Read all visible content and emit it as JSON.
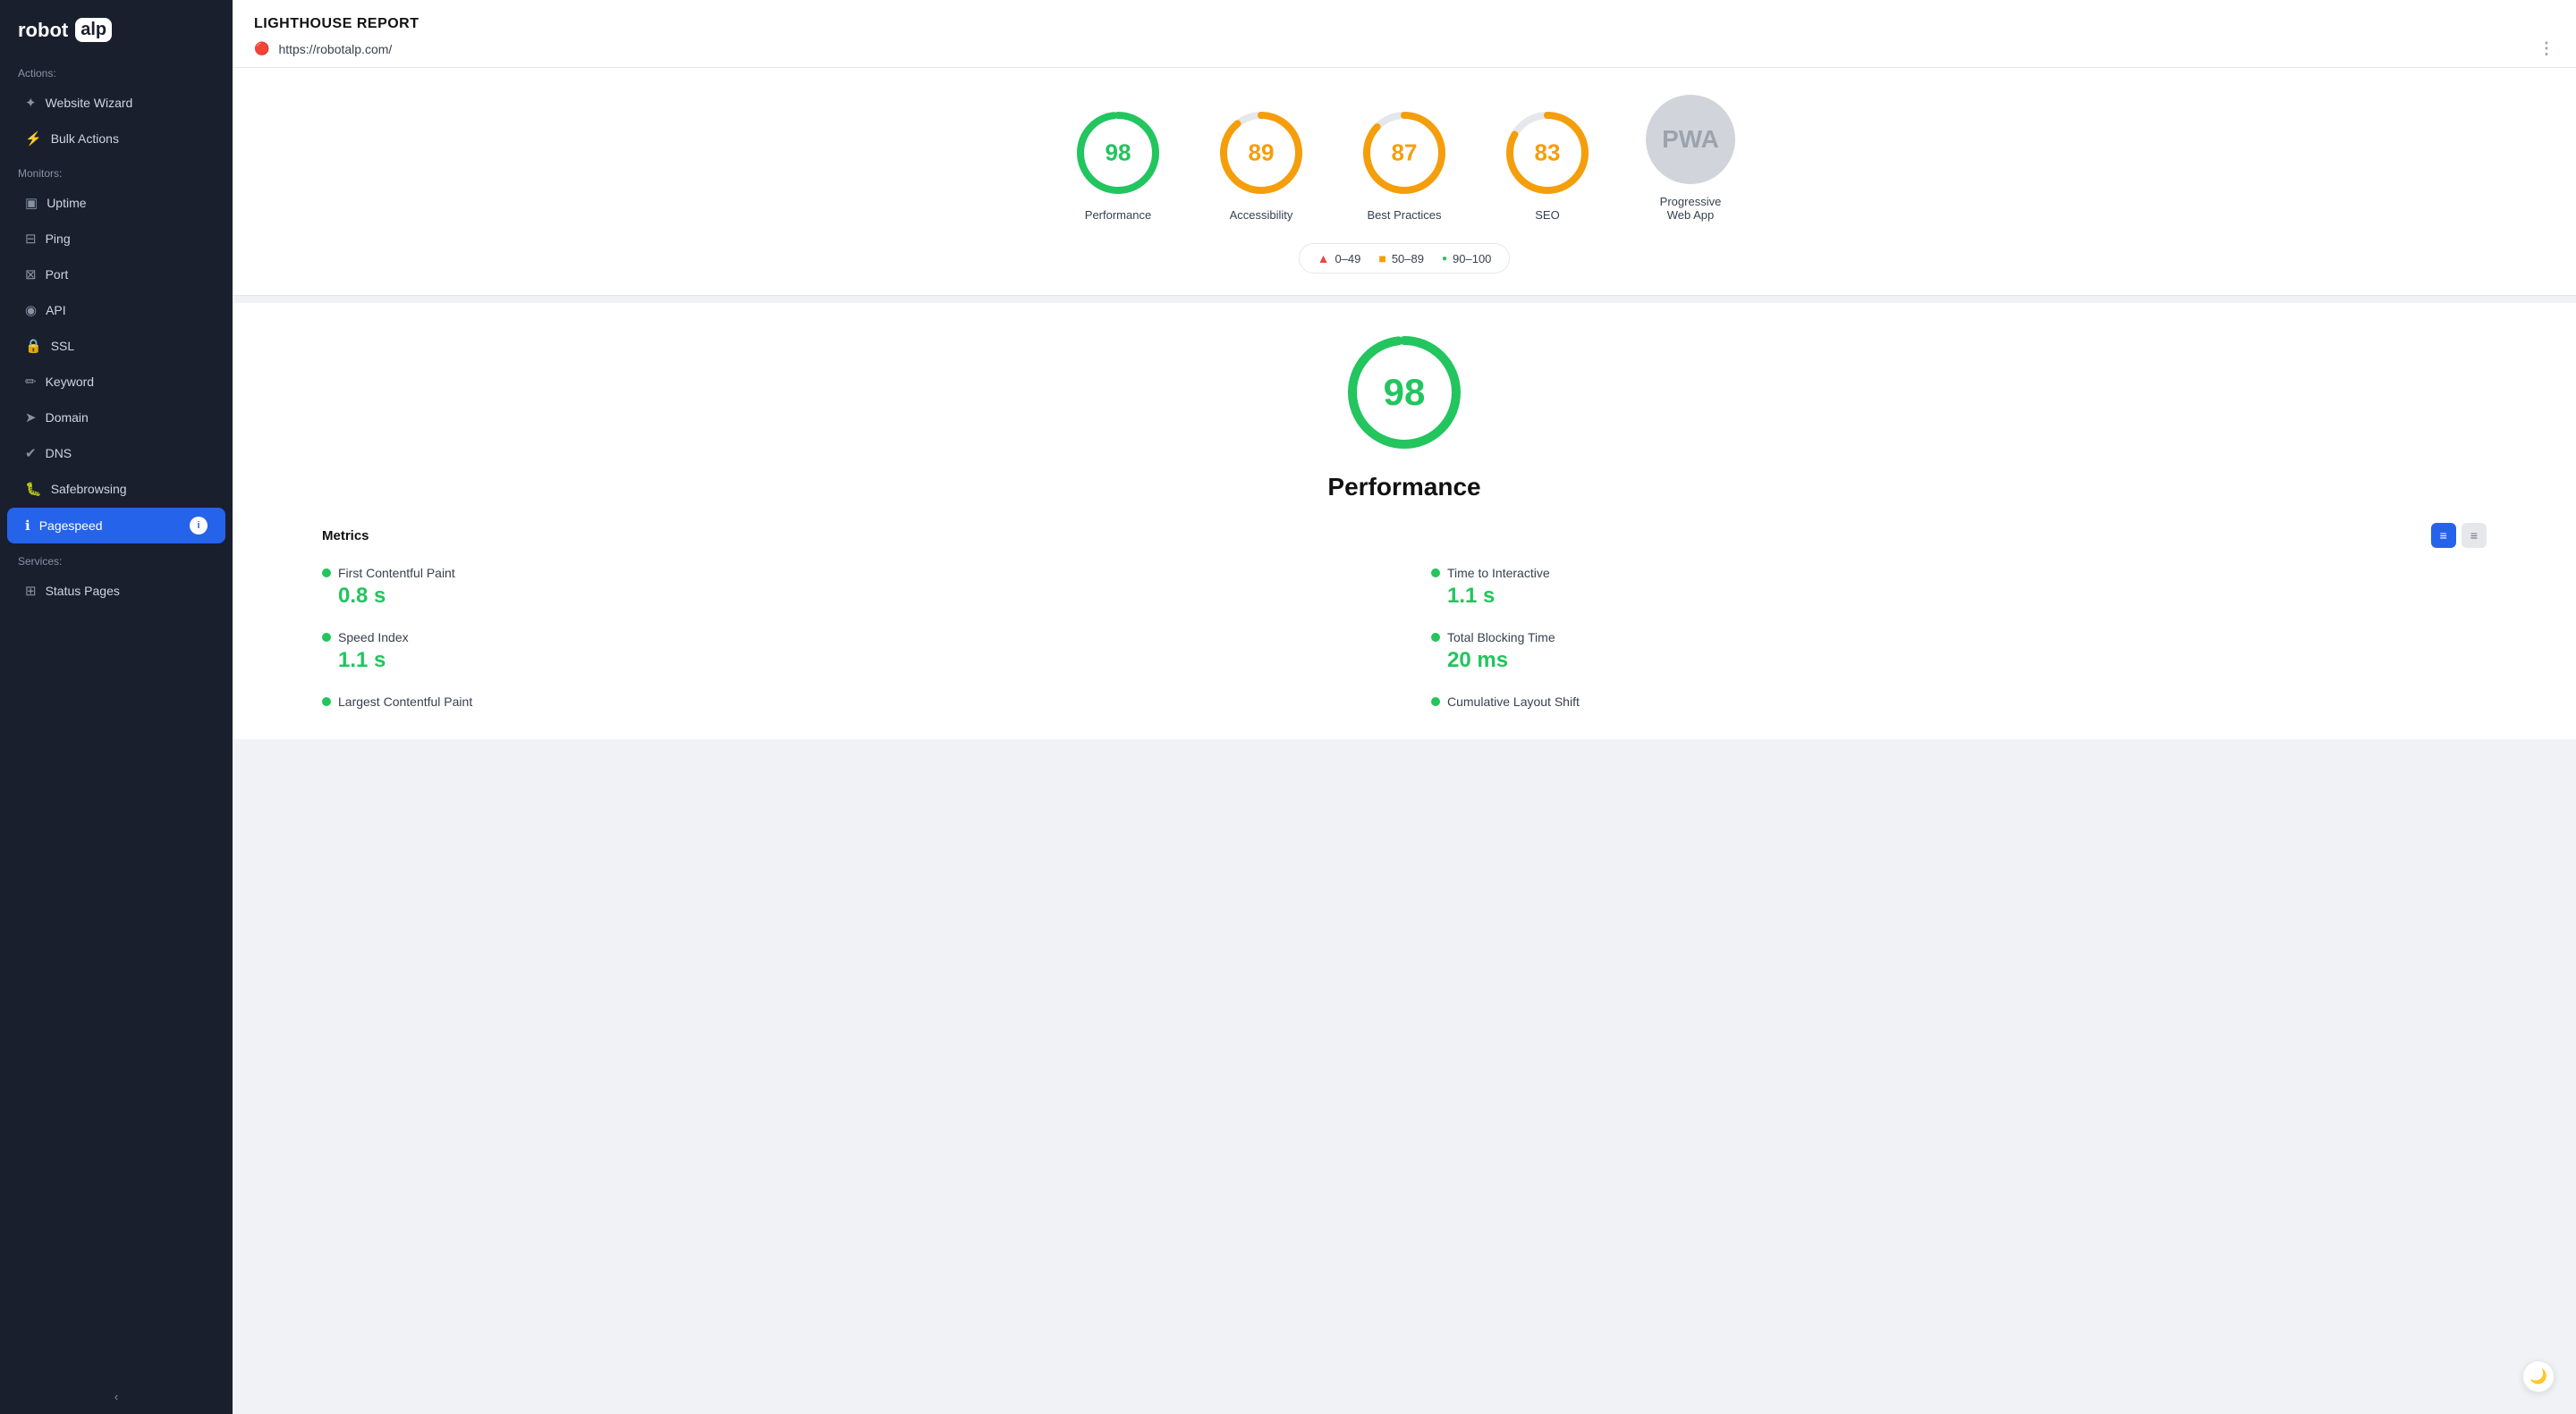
{
  "app": {
    "name": "robot",
    "logo_highlight": "alp"
  },
  "sidebar": {
    "sections": [
      {
        "label": "Actions:",
        "items": [
          {
            "id": "website-wizard",
            "label": "Website Wizard",
            "icon": "✦",
            "active": false
          },
          {
            "id": "bulk-actions",
            "label": "Bulk Actions",
            "icon": "⚡",
            "active": false
          }
        ]
      },
      {
        "label": "Monitors:",
        "items": [
          {
            "id": "uptime",
            "label": "Uptime",
            "icon": "▣",
            "active": false
          },
          {
            "id": "ping",
            "label": "Ping",
            "icon": "⊟",
            "active": false
          },
          {
            "id": "port",
            "label": "Port",
            "icon": "⊠",
            "active": false
          },
          {
            "id": "api",
            "label": "API",
            "icon": "◉",
            "active": false
          },
          {
            "id": "ssl",
            "label": "SSL",
            "icon": "🔒",
            "active": false
          },
          {
            "id": "keyword",
            "label": "Keyword",
            "icon": "✏",
            "active": false
          },
          {
            "id": "domain",
            "label": "Domain",
            "icon": "➤",
            "active": false
          },
          {
            "id": "dns",
            "label": "DNS",
            "icon": "✔",
            "active": false
          },
          {
            "id": "safebrowsing",
            "label": "Safebrowsing",
            "icon": "🐛",
            "active": false
          },
          {
            "id": "pagespeed",
            "label": "Pagespeed",
            "icon": "ℹ",
            "active": true
          }
        ]
      },
      {
        "label": "Services:",
        "items": [
          {
            "id": "status-pages",
            "label": "Status Pages",
            "icon": "⊞",
            "active": false
          }
        ]
      }
    ],
    "collapse_label": "‹"
  },
  "report": {
    "title": "LIGHTHOUSE REPORT",
    "url": "https://robotalp.com/",
    "url_icon": "🔴",
    "scores": [
      {
        "id": "performance",
        "value": 98,
        "label": "Performance",
        "color": "green",
        "stroke_color": "#22c55e",
        "percent": 98
      },
      {
        "id": "accessibility",
        "value": 89,
        "label": "Accessibility",
        "color": "orange",
        "stroke_color": "#f59e0b",
        "percent": 89
      },
      {
        "id": "best-practices",
        "value": 87,
        "label": "Best Practices",
        "color": "orange",
        "stroke_color": "#f59e0b",
        "percent": 87
      },
      {
        "id": "seo",
        "value": 83,
        "label": "SEO",
        "color": "orange",
        "stroke_color": "#f59e0b",
        "percent": 83
      }
    ],
    "pwa": {
      "label": "Progressive\nWeb App",
      "value": "—"
    },
    "legend": [
      {
        "id": "low",
        "range": "0–49",
        "color": "#ef4444",
        "symbol": "▲"
      },
      {
        "id": "mid",
        "range": "50–89",
        "color": "#f59e0b",
        "symbol": "■"
      },
      {
        "id": "high",
        "range": "90–100",
        "color": "#22c55e",
        "symbol": "●"
      }
    ],
    "detail": {
      "score": 98,
      "title": "Performance",
      "metrics_title": "Metrics",
      "metrics": [
        {
          "id": "fcp",
          "label": "First Contentful Paint",
          "value": "0.8 s",
          "color": "#22c55e"
        },
        {
          "id": "tti",
          "label": "Time to Interactive",
          "value": "1.1 s",
          "color": "#22c55e"
        },
        {
          "id": "si",
          "label": "Speed Index",
          "value": "1.1 s",
          "color": "#22c55e"
        },
        {
          "id": "tbt",
          "label": "Total Blocking Time",
          "value": "20 ms",
          "color": "#22c55e"
        },
        {
          "id": "lcp",
          "label": "Largest Contentful Paint",
          "value": "",
          "color": "#22c55e"
        },
        {
          "id": "cls",
          "label": "Cumulative Layout Shift",
          "value": "",
          "color": "#22c55e"
        }
      ]
    },
    "view_toggle": [
      {
        "id": "grid-view",
        "icon": "≡",
        "active": true
      },
      {
        "id": "list-view",
        "icon": "≡",
        "active": false
      }
    ]
  }
}
